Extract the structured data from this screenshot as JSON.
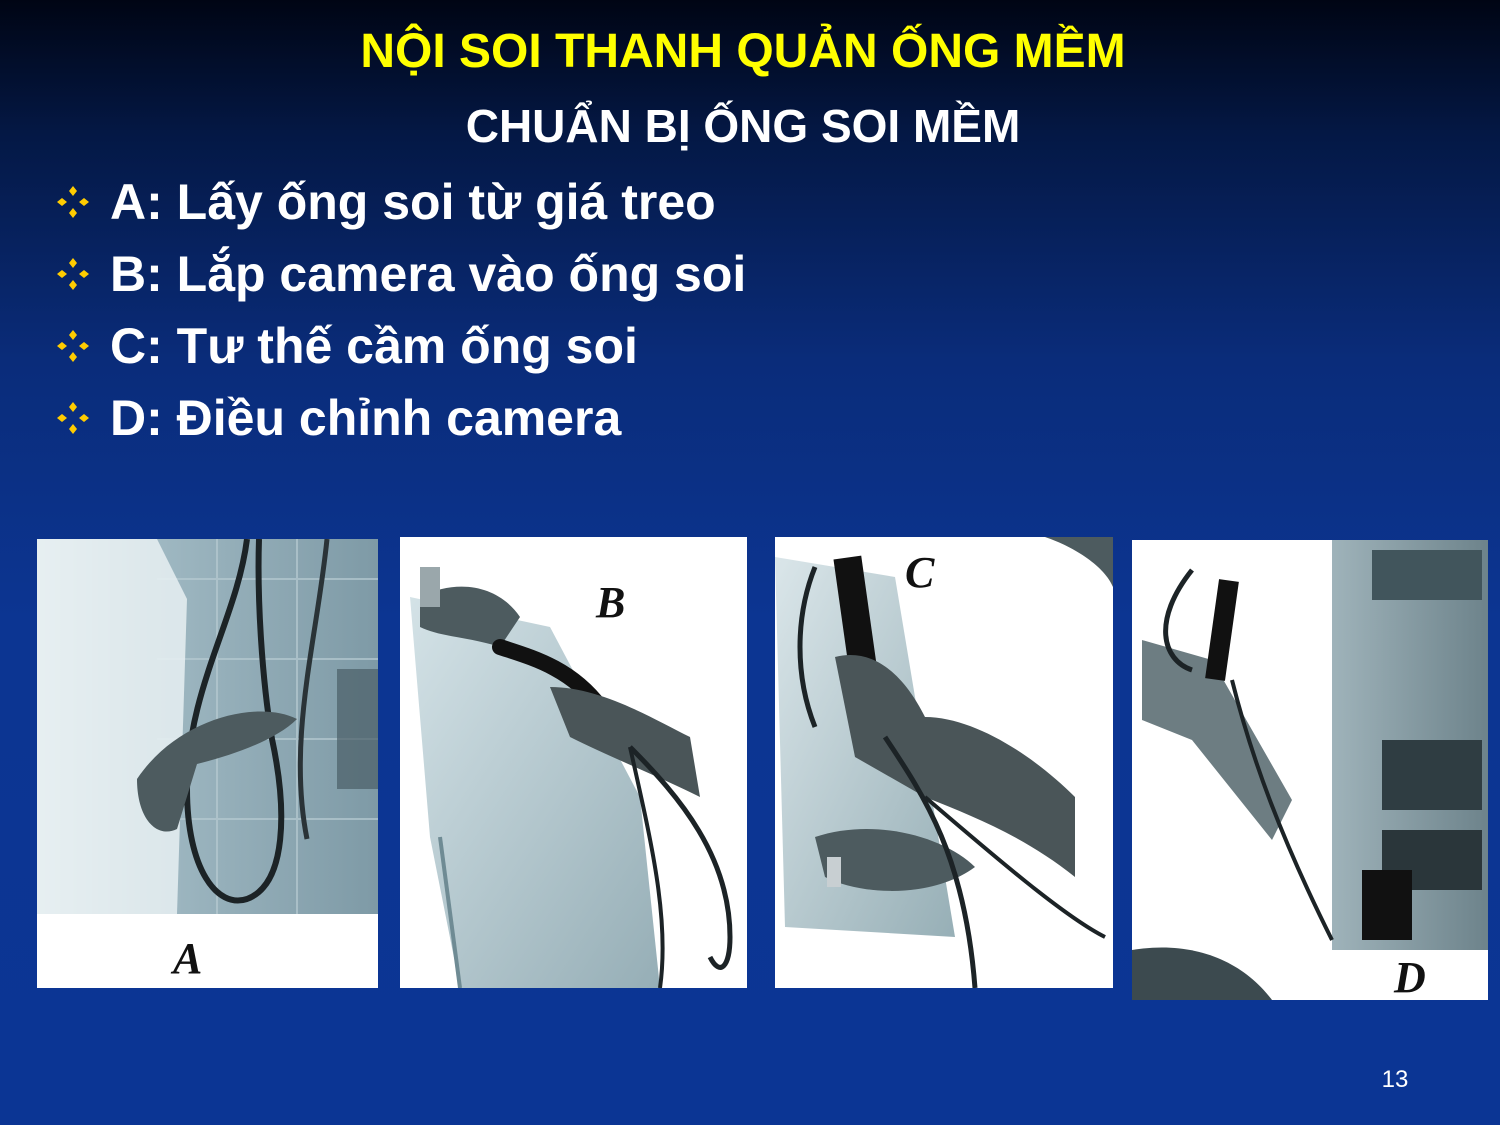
{
  "slide": {
    "title": "NỘI SOI THANH QUẢN ỐNG MỀM",
    "subtitle": "CHUẨN BỊ ỐNG SOI MỀM",
    "bullet_color": "#ffcc00",
    "bullets": [
      "A: Lấy ống soi từ giá treo",
      "B: Lắp camera vào ống soi",
      "C: Tư thế cầm ống soi",
      "D: Điều chỉnh camera"
    ],
    "photos": [
      {
        "label": "A",
        "icon": "hand-holding-endoscope-from-rack"
      },
      {
        "label": "B",
        "icon": "attaching-camera-to-endoscope"
      },
      {
        "label": "C",
        "icon": "holding-endoscope-posture"
      },
      {
        "label": "D",
        "icon": "adjusting-camera-equipment"
      }
    ],
    "page_number": "13"
  }
}
